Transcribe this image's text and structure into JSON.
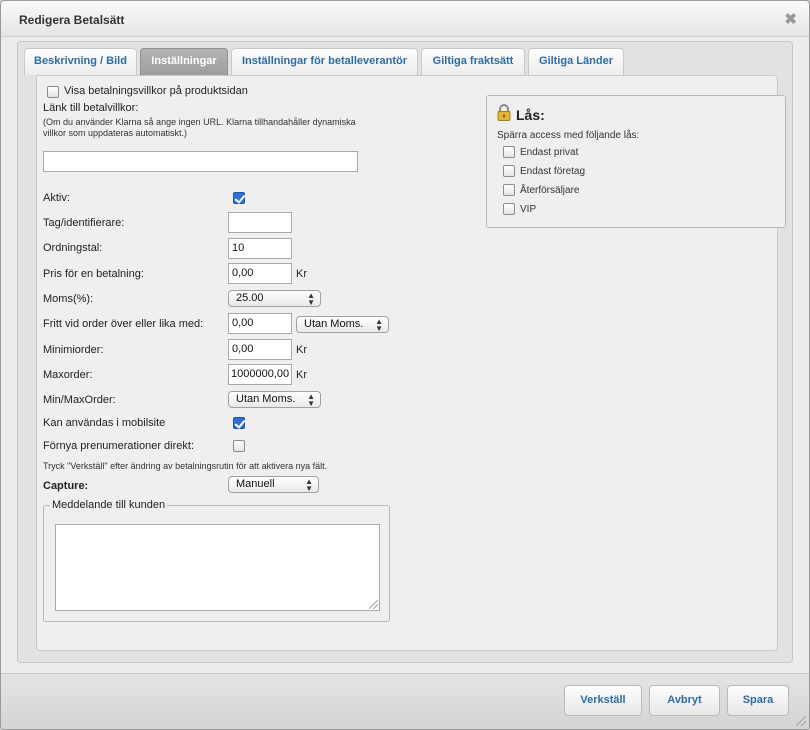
{
  "window": {
    "title": "Redigera Betalsätt",
    "close_icon": "close-icon"
  },
  "tabs": [
    {
      "label": "Beskrivning / Bild",
      "active": false
    },
    {
      "label": "Inställningar",
      "active": true
    },
    {
      "label": "Inställningar för betalleverantör",
      "active": false
    },
    {
      "label": "Giltiga fraktsätt",
      "active": false
    },
    {
      "label": "Giltiga Länder",
      "active": false
    }
  ],
  "settings": {
    "show_terms_label": "Visa betalningsvillkor på produktsidan",
    "show_terms_checked": false,
    "terms_link_label": "Länk till betalvillkor:",
    "terms_link_help": "(Om du använder Klarna så ange ingen URL. Klarna tillhandahåller dynamiska villkor som uppdateras automatiskt.)",
    "terms_link_value": "",
    "active_label": "Aktiv:",
    "active_checked": true,
    "tag_label": "Tag/identifierare:",
    "tag_value": "",
    "order_label": "Ordningstal:",
    "order_value": "10",
    "price_label": "Pris för en betalning:",
    "price_value": "0,00",
    "price_unit": "Kr",
    "vat_label": "Moms(%):",
    "vat_value": "25.00",
    "free_label": "Fritt vid order över eller lika med:",
    "free_value": "0,00",
    "free_select": "Utan Moms.",
    "min_label": "Minimiorder:",
    "min_value": "0,00",
    "min_unit": "Kr",
    "max_label": "Maxorder:",
    "max_value": "1000000,00",
    "max_unit": "Kr",
    "minmax_label": "Min/MaxOrder:",
    "minmax_select": "Utan Moms.",
    "mobile_label": "Kan användas i mobilsite",
    "mobile_checked": true,
    "renew_label": "Förnya prenumerationer direkt:",
    "renew_checked": false,
    "apply_hint": "Tryck \"Verkställ\" efter ändring av betalningsrutin för att aktivera nya fält.",
    "capture_label": "Capture:",
    "capture_select": "Manuell",
    "message_legend": "Meddelande till kunden",
    "message_value": ""
  },
  "lock": {
    "title": "Lås:",
    "icon": "lock-icon",
    "subtitle": "Spärra access med följande lås:",
    "options": [
      {
        "label": "Endast privat",
        "checked": false
      },
      {
        "label": "Endast företag",
        "checked": false
      },
      {
        "label": "Återförsäljare",
        "checked": false
      },
      {
        "label": "VIP",
        "checked": false
      }
    ]
  },
  "buttons": {
    "apply": "Verkställ",
    "cancel": "Avbryt",
    "save": "Spara"
  },
  "colors": {
    "link_blue": "#2e6da4",
    "check_blue": "#2f6fd2",
    "active_tab": "#a8a8a8"
  }
}
